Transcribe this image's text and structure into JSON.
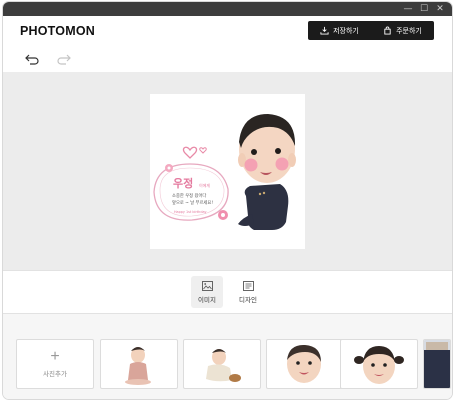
{
  "app": {
    "logo": "PHOTOMON"
  },
  "window_controls": {
    "minimize": "—",
    "maximize": "☐",
    "close": "✕"
  },
  "header": {
    "save_label": "저장하기",
    "order_label": "주문하기"
  },
  "canvas": {
    "sticker": {
      "name": "우정",
      "name_suffix": "이에게",
      "message_line1": "소중한 우정 왔어다",
      "message_line2": "앞으로 ~ 날 부르세요!",
      "small_text": "Happy 1st birthday"
    }
  },
  "tabs": [
    {
      "label": "이미지",
      "icon": "image-icon",
      "active": true
    },
    {
      "label": "디자인",
      "icon": "design-icon",
      "active": false
    }
  ],
  "tray": {
    "add_label": "사진추가",
    "thumbnails": [
      "baby-sitting-photo",
      "baby-lying-photo",
      "baby-face-photo",
      "baby-pigtails-photo",
      "partial-photo"
    ]
  },
  "colors": {
    "accent_dark": "#1b1b1b",
    "pink": "#e4799e",
    "canvas_bg": "#ececec"
  }
}
